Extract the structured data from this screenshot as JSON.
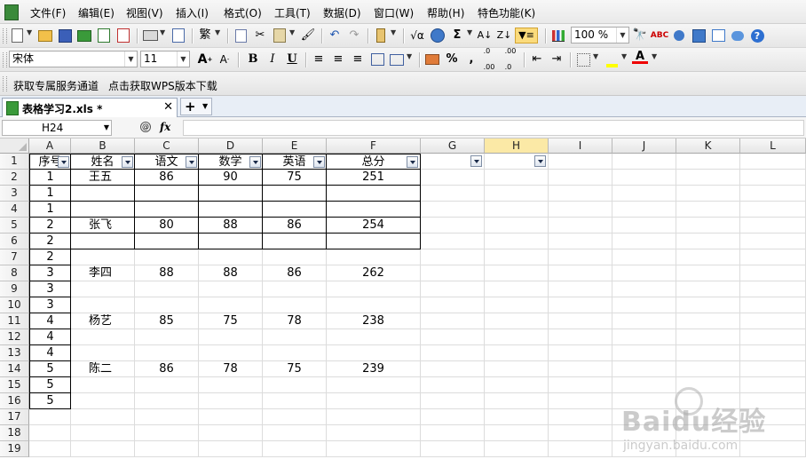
{
  "menu": {
    "items": [
      "文件(F)",
      "编辑(E)",
      "视图(V)",
      "插入(I)",
      "格式(O)",
      "工具(T)",
      "数据(D)",
      "窗口(W)",
      "帮助(H)",
      "特色功能(K)"
    ]
  },
  "toolbar": {
    "zoom": "100 %",
    "font_name": "宋体",
    "font_size": "11"
  },
  "service_bar": {
    "link1": "获取专属服务通道",
    "link2": "点击获取WPS版本下载"
  },
  "document_tab": {
    "title": "表格学习2.xls *"
  },
  "formula_bar": {
    "name_box": "H24",
    "fx_label": "fx",
    "formula": ""
  },
  "grid": {
    "columns": [
      "A",
      "B",
      "C",
      "D",
      "E",
      "F",
      "G",
      "H",
      "I",
      "J",
      "K",
      "L"
    ],
    "selected_column": "H",
    "rows": [
      "1",
      "2",
      "3",
      "4",
      "5",
      "6",
      "7",
      "8",
      "9",
      "10",
      "11",
      "12",
      "13",
      "14",
      "15",
      "16",
      "17",
      "18",
      "19"
    ],
    "header": [
      "序号",
      "姓名",
      "语文",
      "数学",
      "英语",
      "总分"
    ],
    "data": [
      [
        "1",
        "王五",
        "86",
        "90",
        "75",
        "251"
      ],
      [
        "1",
        "",
        "",
        "",
        "",
        ""
      ],
      [
        "1",
        "",
        "",
        "",
        "",
        ""
      ],
      [
        "2",
        "张飞",
        "80",
        "88",
        "86",
        "254"
      ],
      [
        "2",
        "",
        "",
        "",
        "",
        ""
      ],
      [
        "2",
        "",
        "",
        "",
        "",
        ""
      ],
      [
        "3",
        "李四",
        "88",
        "88",
        "86",
        "262"
      ],
      [
        "3",
        "",
        "",
        "",
        "",
        ""
      ],
      [
        "3",
        "",
        "",
        "",
        "",
        ""
      ],
      [
        "4",
        "杨艺",
        "85",
        "75",
        "78",
        "238"
      ],
      [
        "4",
        "",
        "",
        "",
        "",
        ""
      ],
      [
        "4",
        "",
        "",
        "",
        "",
        ""
      ],
      [
        "5",
        "陈二",
        "86",
        "78",
        "75",
        "239"
      ],
      [
        "5",
        "",
        "",
        "",
        "",
        ""
      ],
      [
        "5",
        "",
        "",
        "",
        "",
        ""
      ],
      [
        "",
        "",
        "",
        "",
        "",
        ""
      ],
      [
        "",
        "",
        "",
        "",
        "",
        ""
      ],
      [
        "",
        "",
        "",
        "",
        "",
        ""
      ]
    ]
  },
  "watermark": {
    "brand": "Baidu经验",
    "url": "jingyan.baidu.com"
  }
}
